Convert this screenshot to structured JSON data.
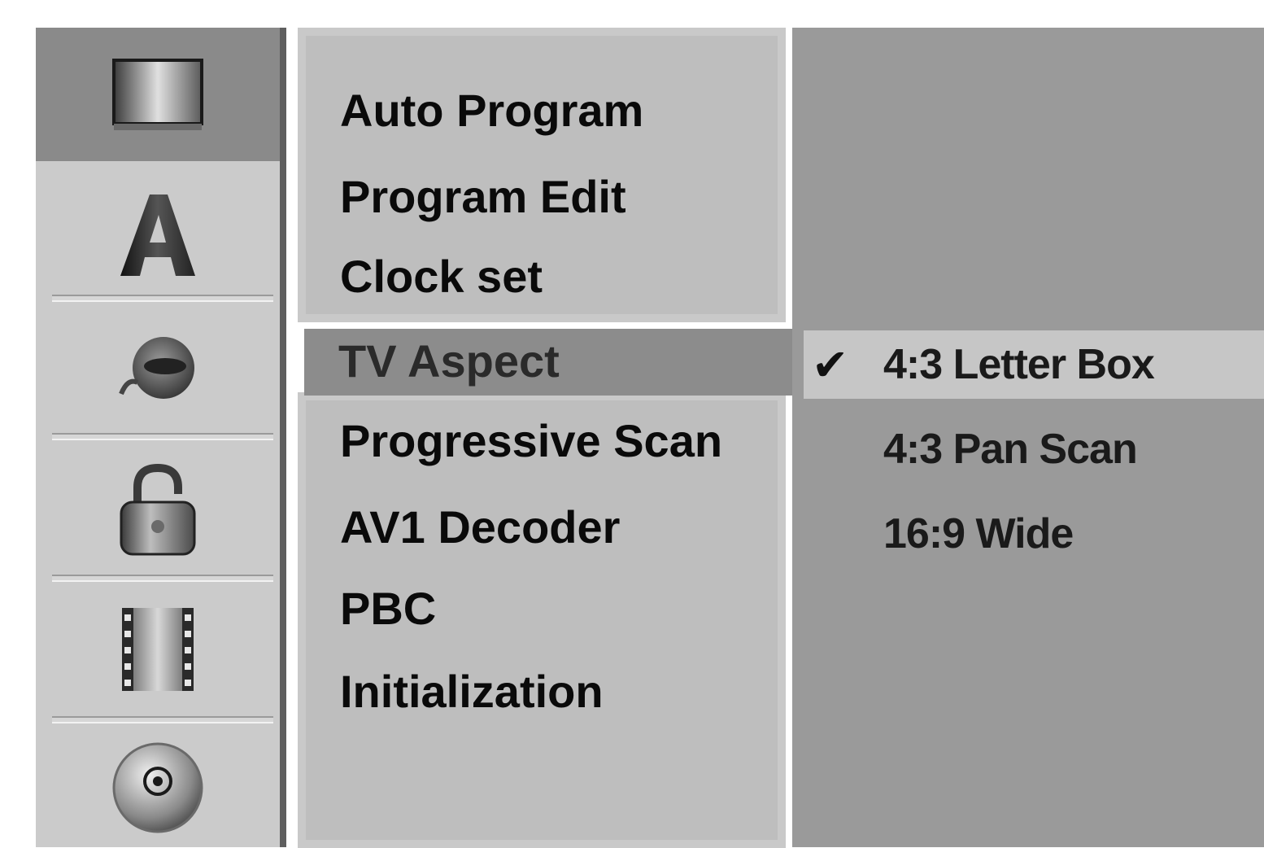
{
  "sidebar": {
    "icons": [
      {
        "name": "general-settings-icon",
        "active": true
      },
      {
        "name": "language-icon"
      },
      {
        "name": "audio-icon"
      },
      {
        "name": "lock-icon"
      },
      {
        "name": "recording-film-icon"
      },
      {
        "name": "disc-icon"
      }
    ]
  },
  "menu": {
    "items": [
      {
        "label": "Auto Program"
      },
      {
        "label": "Program Edit"
      },
      {
        "label": "Clock set"
      },
      {
        "label": "TV Aspect",
        "selected": true
      },
      {
        "label": "Progressive Scan"
      },
      {
        "label": "AV1 Decoder"
      },
      {
        "label": "PBC"
      },
      {
        "label": "Initialization"
      }
    ]
  },
  "options": {
    "check_mark": "✔",
    "items": [
      {
        "label": "4:3 Letter Box",
        "checked": true
      },
      {
        "label": "4:3 Pan Scan"
      },
      {
        "label": "16:9 Wide"
      }
    ]
  },
  "colors": {
    "selected_row": "#8c8c8c",
    "option_area": "#9a9a9a",
    "menu_bg": "#bebebe"
  }
}
